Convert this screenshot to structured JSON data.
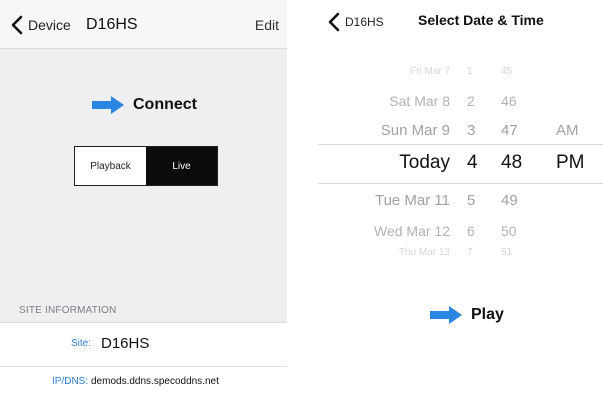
{
  "left_screen": {
    "navbar": {
      "back_label": "Device",
      "title": "D16HS",
      "edit_label": "Edit"
    },
    "connect_label": "Connect",
    "mode_segment": {
      "options": [
        "Playback",
        "Live"
      ],
      "selected": "Live"
    },
    "site_information": {
      "header": "SITE INFORMATION",
      "site_key": "Site:",
      "site_value": "D16HS",
      "ipdns_key": "IP/DNS:",
      "ipdns_value": "demods.ddns.specoddns.net"
    }
  },
  "right_screen": {
    "navbar": {
      "back_label": "D16HS",
      "title": "Select Date & Time"
    },
    "picker": {
      "rows": [
        {
          "date": "Fri Mar 7",
          "hour": "1",
          "minute": "45",
          "ampm": ""
        },
        {
          "date": "Sat Mar 8",
          "hour": "2",
          "minute": "46",
          "ampm": ""
        },
        {
          "date": "Sun Mar 9",
          "hour": "3",
          "minute": "47",
          "ampm": "AM"
        },
        {
          "date": "Today",
          "hour": "4",
          "minute": "48",
          "ampm": "PM"
        },
        {
          "date": "Tue Mar 11",
          "hour": "5",
          "minute": "49",
          "ampm": ""
        },
        {
          "date": "Wed Mar 12",
          "hour": "6",
          "minute": "50",
          "ampm": ""
        },
        {
          "date": "Thu Mar 13",
          "hour": "7",
          "minute": "51",
          "ampm": ""
        }
      ],
      "selected_index": 3
    },
    "play_label": "Play"
  },
  "colors": {
    "accent_blue": "#2a86e0",
    "link_blue": "#2f7fd0",
    "segment_dark": "#0b0b0b"
  },
  "icons": {
    "back": "chevron-left-icon",
    "connect": "arrow-right-icon",
    "play": "arrow-right-icon"
  }
}
